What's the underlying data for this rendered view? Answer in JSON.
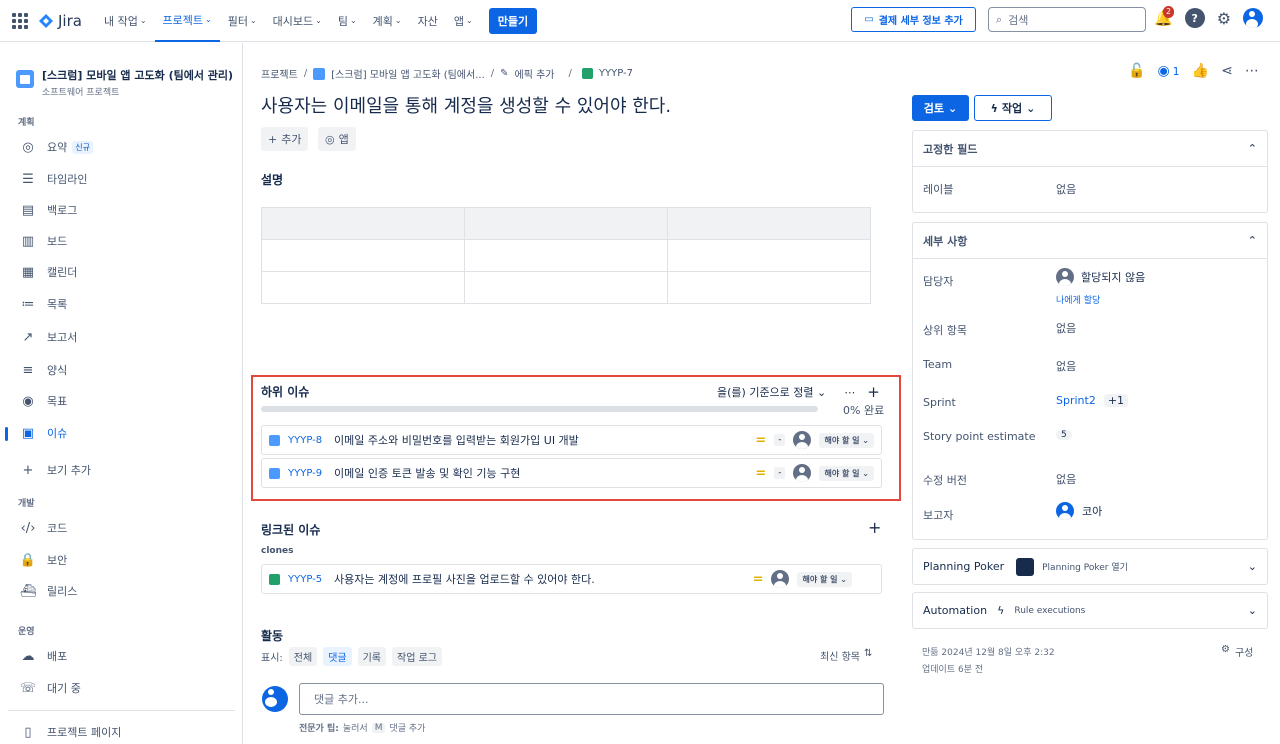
{
  "nav": {
    "brand": "Jira",
    "items": [
      "내 작업",
      "프로젝트",
      "필터",
      "대시보드",
      "팀",
      "계획",
      "자산",
      "앱"
    ],
    "create": "만들기",
    "billing": "결제 세부 정보 추가",
    "search_placeholder": "검색",
    "notif_count": "2",
    "icons": [
      "app-switcher-icon",
      "notification-icon",
      "help-icon",
      "settings-icon",
      "profile-icon"
    ]
  },
  "sidebar": {
    "project_name": "[스크럼] 모바일 앱 고도화 (팀에서 관리)",
    "project_type": "소프트웨어 프로젝트",
    "section_plan": "계획",
    "items": [
      {
        "label": "요약",
        "icon": "globe-icon"
      },
      {
        "label": "타임라인",
        "icon": "timeline-icon"
      },
      {
        "label": "백로그",
        "icon": "backlog-icon"
      },
      {
        "label": "보드",
        "icon": "board-icon"
      },
      {
        "label": "캘린더",
        "icon": "calendar-icon"
      },
      {
        "label": "목록",
        "icon": "list-icon"
      },
      {
        "label": "보고서",
        "icon": "chart-icon"
      },
      {
        "label": "양식",
        "icon": "form-icon"
      },
      {
        "label": "목표",
        "icon": "target-icon"
      },
      {
        "label": "이슈",
        "icon": "issue-icon"
      },
      {
        "label": "보기 추가",
        "icon": "plus-icon"
      }
    ],
    "new_lozenge": "신규",
    "section_dev": "개발",
    "dev_items": [
      {
        "label": "코드",
        "icon": "code-icon"
      },
      {
        "label": "보안",
        "icon": "lock-icon"
      },
      {
        "label": "릴리스",
        "icon": "ship-icon"
      }
    ],
    "section_ops": "운영",
    "ops_items": [
      {
        "label": "배포",
        "icon": "cloud-upload-icon"
      },
      {
        "label": "대기 중",
        "icon": "oncall-icon"
      }
    ],
    "project_page": "프로젝트 페이지"
  },
  "breadcrumb": {
    "root": "프로젝트",
    "project": "[스크럼] 모바일 앱 고도화 (팀에서...",
    "epic": "에픽 추가",
    "key": "YYYP-7"
  },
  "issue": {
    "title": "사용자는 이메일을 통해 계정을 생성할 수 있어야 한다.",
    "add_btn": "추가",
    "apps_btn": "앱",
    "desc_heading": "설명",
    "subtasks_heading": "하위 이슈",
    "sort_label": "을(를) 기준으로 정렬",
    "progress": 0,
    "progress_text": "0% 완료",
    "children": [
      {
        "key": "YYYP-8",
        "summary": "이메일 주소와 비밀번호를 입력받는 회원가입 UI 개발",
        "estimate": "-",
        "status": "해야 할 일"
      },
      {
        "key": "YYYP-9",
        "summary": "이메일 인증 토큰 발송 및 확인 기능 구현",
        "estimate": "-",
        "status": "해야 할 일"
      }
    ],
    "linked_heading": "링크된 이슈",
    "link_type": "clones",
    "linked": [
      {
        "key": "YYYP-5",
        "summary": "사용자는 계정에 프로필 사진을 업로드할 수 있어야 한다.",
        "status": "해야 할 일"
      }
    ],
    "activity_heading": "활동",
    "show_label": "표시:",
    "tabs": [
      "전체",
      "댓글",
      "기록",
      "작업 로그"
    ],
    "sort_newest": "최신 항목",
    "comment_placeholder": "댓글 추가...",
    "tip_bold": "전문가 팁:",
    "tip_text1": "눌러서",
    "tip_key": "M",
    "tip_text2": "댓글 추가"
  },
  "right": {
    "watch_count": "1",
    "status_btn": "검토",
    "action_btn": "작업",
    "pinned_heading": "고정한 필드",
    "label_field": "레이블",
    "none": "없음",
    "details_heading": "세부 사항",
    "assignee_label": "담당자",
    "assignee_value": "할당되지 않음",
    "assign_me": "나에게 할당",
    "parent_label": "상위 항목",
    "team_label": "Team",
    "sprint_label": "Sprint",
    "sprint_value": "Sprint2",
    "sprint_more": "+1",
    "sp_label": "Story point estimate",
    "sp_value": "5",
    "fix_label": "수정 버전",
    "reporter_label": "보고자",
    "reporter_value": "코아",
    "poker_heading": "Planning Poker",
    "poker_open": "Planning Poker 열기",
    "auto_heading": "Automation",
    "rule_exec": "Rule executions",
    "created": "만듦 2024년 12월 8일 오후 2:32",
    "updated": "업데이트 6분 전",
    "configure": "구성"
  }
}
